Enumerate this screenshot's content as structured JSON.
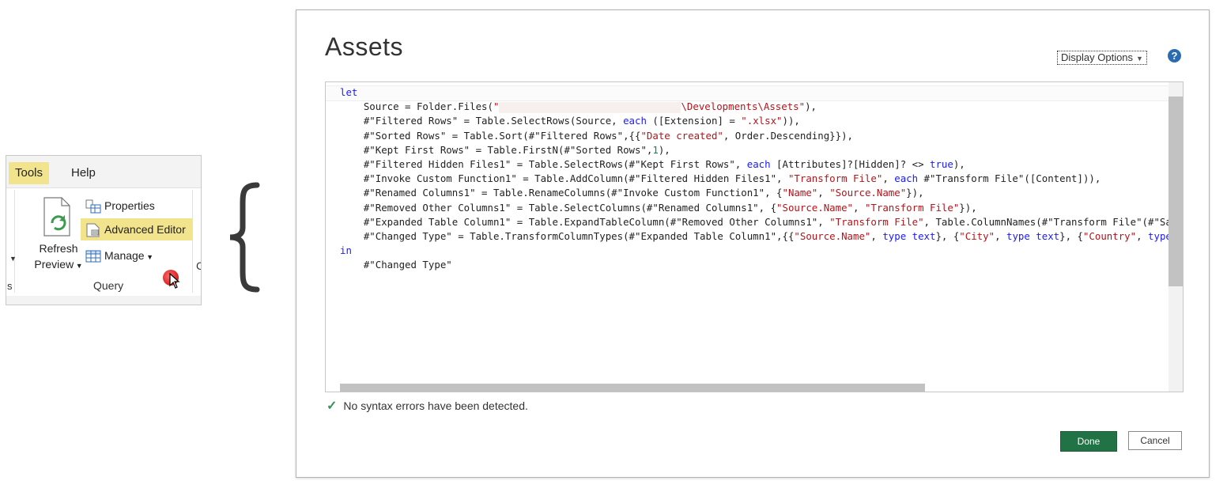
{
  "ribbon": {
    "tabs": [
      "Tools",
      "Help"
    ],
    "refresh_label_1": "Refresh",
    "refresh_label_2": "Preview",
    "properties": "Properties",
    "advanced_editor": "Advanced Editor",
    "manage": "Manage",
    "group": "Query",
    "fragment_c": "C",
    "fragment_s": "s"
  },
  "dialog": {
    "title": "Assets",
    "display_options": "Display Options",
    "help": "?",
    "status": "No syntax errors have been detected.",
    "done": "Done",
    "cancel": "Cancel"
  },
  "editor": {
    "code_lines": [
      [
        {
          "t": "let",
          "c": "kw"
        }
      ],
      [
        {
          "t": "    Source = Folder.Files(",
          "c": ""
        },
        {
          "t": "\"",
          "c": "str"
        },
        {
          "t": "",
          "c": "redact"
        },
        {
          "t": "\\Developments\\Assets\"",
          "c": "str"
        },
        {
          "t": "),",
          "c": ""
        }
      ],
      [
        {
          "t": "    #\"Filtered Rows\" = Table.SelectRows(Source, ",
          "c": ""
        },
        {
          "t": "each",
          "c": "kw"
        },
        {
          "t": " ([Extension] = ",
          "c": ""
        },
        {
          "t": "\".xlsx\"",
          "c": "str"
        },
        {
          "t": ")),",
          "c": ""
        }
      ],
      [
        {
          "t": "    #\"Sorted Rows\" = Table.Sort(#\"Filtered Rows\",{{",
          "c": ""
        },
        {
          "t": "\"Date created\"",
          "c": "str"
        },
        {
          "t": ", Order.Descending}}),",
          "c": ""
        }
      ],
      [
        {
          "t": "    #\"Kept First Rows\" = Table.FirstN(#\"Sorted Rows\",",
          "c": ""
        },
        {
          "t": "1",
          "c": "num"
        },
        {
          "t": "),",
          "c": ""
        }
      ],
      [
        {
          "t": "    #\"Filtered Hidden Files1\" = Table.SelectRows(#\"Kept First Rows\", ",
          "c": ""
        },
        {
          "t": "each",
          "c": "kw"
        },
        {
          "t": " [Attributes]?[Hidden]? <> ",
          "c": ""
        },
        {
          "t": "true",
          "c": "kw"
        },
        {
          "t": "),",
          "c": ""
        }
      ],
      [
        {
          "t": "    #\"Invoke Custom Function1\" = Table.AddColumn(#\"Filtered Hidden Files1\", ",
          "c": ""
        },
        {
          "t": "\"Transform File\"",
          "c": "str"
        },
        {
          "t": ", ",
          "c": ""
        },
        {
          "t": "each",
          "c": "kw"
        },
        {
          "t": " #\"Transform File\"([Content])),",
          "c": ""
        }
      ],
      [
        {
          "t": "    #\"Renamed Columns1\" = Table.RenameColumns(#\"Invoke Custom Function1\", {",
          "c": ""
        },
        {
          "t": "\"Name\"",
          "c": "str"
        },
        {
          "t": ", ",
          "c": ""
        },
        {
          "t": "\"Source.Name\"",
          "c": "str"
        },
        {
          "t": "}),",
          "c": ""
        }
      ],
      [
        {
          "t": "    #\"Removed Other Columns1\" = Table.SelectColumns(#\"Renamed Columns1\", {",
          "c": ""
        },
        {
          "t": "\"Source.Name\"",
          "c": "str"
        },
        {
          "t": ", ",
          "c": ""
        },
        {
          "t": "\"Transform File\"",
          "c": "str"
        },
        {
          "t": "}),",
          "c": ""
        }
      ],
      [
        {
          "t": "    #\"Expanded Table Column1\" = Table.ExpandTableColumn(#\"Removed Other Columns1\", ",
          "c": ""
        },
        {
          "t": "\"Transform File\"",
          "c": "str"
        },
        {
          "t": ", Table.ColumnNames(#\"Transform File\"(#\"Sam",
          "c": ""
        }
      ],
      [
        {
          "t": "    #\"Changed Type\" = Table.TransformColumnTypes(#\"Expanded Table Column1\",{{",
          "c": ""
        },
        {
          "t": "\"Source.Name\"",
          "c": "str"
        },
        {
          "t": ", ",
          "c": ""
        },
        {
          "t": "type text",
          "c": "kw"
        },
        {
          "t": "}, {",
          "c": ""
        },
        {
          "t": "\"City\"",
          "c": "str"
        },
        {
          "t": ", ",
          "c": ""
        },
        {
          "t": "type text",
          "c": "kw"
        },
        {
          "t": "}, {",
          "c": ""
        },
        {
          "t": "\"Country\"",
          "c": "str"
        },
        {
          "t": ", ",
          "c": ""
        },
        {
          "t": "type",
          "c": "kw"
        }
      ],
      [
        {
          "t": "in",
          "c": "kw"
        }
      ],
      [
        {
          "t": "    #\"Changed Type\"",
          "c": ""
        }
      ]
    ]
  },
  "colors": {
    "tab_highlight": "#f2e48c",
    "done_button": "#217346",
    "keyword": "#1a1aff",
    "string": "#b5141b"
  }
}
